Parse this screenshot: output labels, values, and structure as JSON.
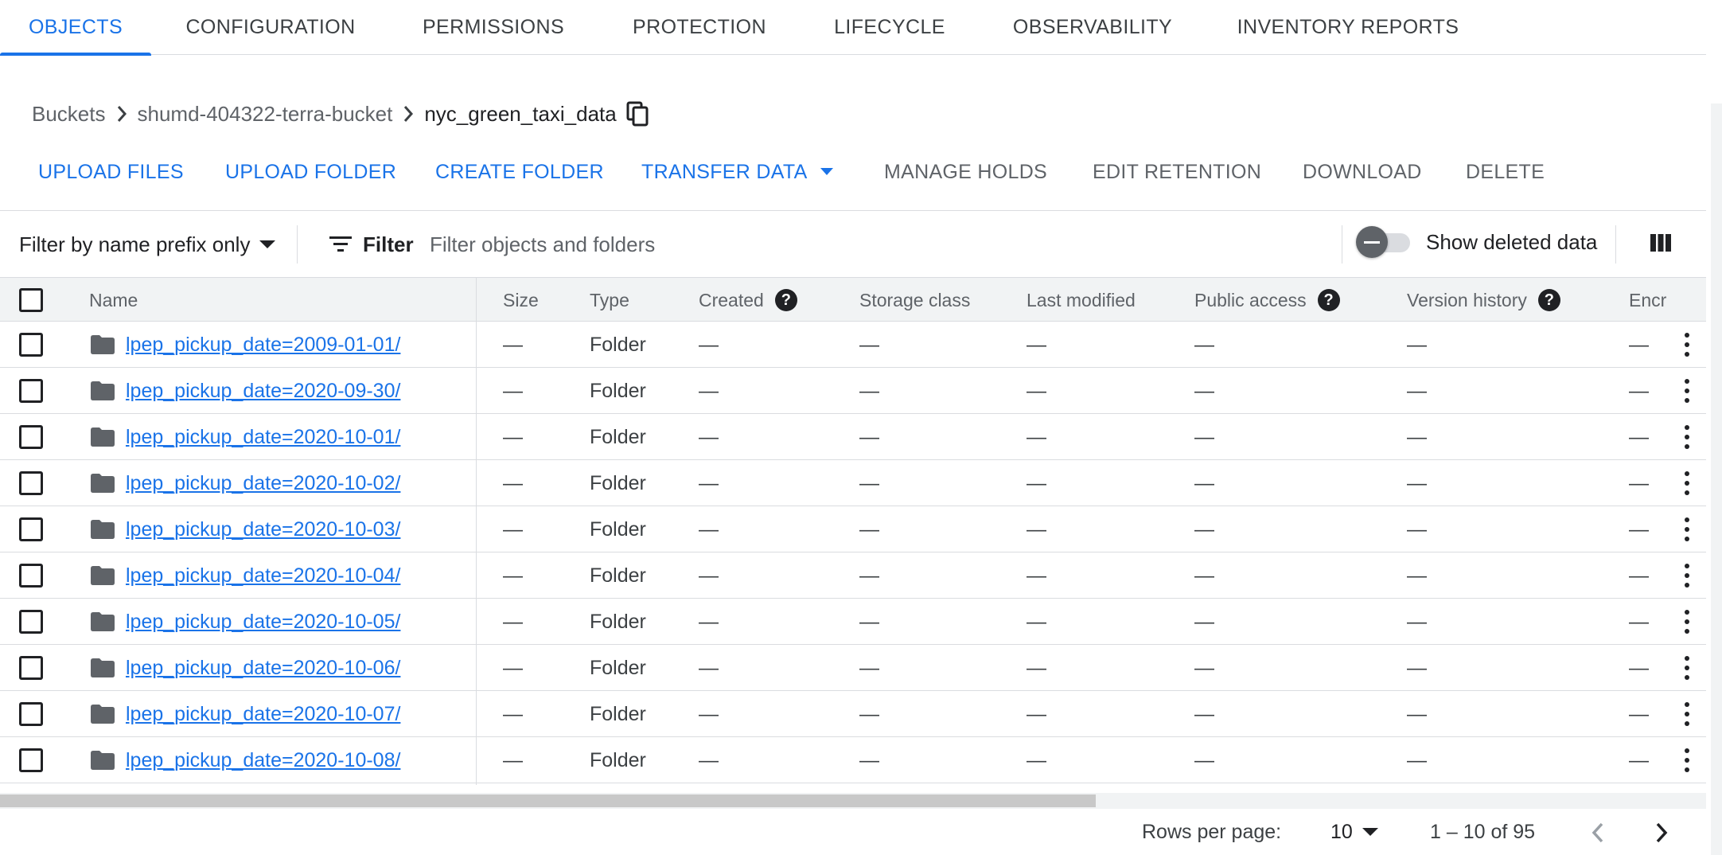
{
  "tabs": [
    {
      "label": "OBJECTS",
      "active": true
    },
    {
      "label": "CONFIGURATION",
      "active": false
    },
    {
      "label": "PERMISSIONS",
      "active": false
    },
    {
      "label": "PROTECTION",
      "active": false
    },
    {
      "label": "LIFECYCLE",
      "active": false
    },
    {
      "label": "OBSERVABILITY",
      "active": false
    },
    {
      "label": "INVENTORY REPORTS",
      "active": false
    }
  ],
  "breadcrumb": {
    "root": "Buckets",
    "bucket": "shumd-404322-terra-bucket",
    "current": "nyc_green_taxi_data"
  },
  "actions": {
    "upload_files": "UPLOAD FILES",
    "upload_folder": "UPLOAD FOLDER",
    "create_folder": "CREATE FOLDER",
    "transfer_data": "TRANSFER DATA",
    "manage_holds": "MANAGE HOLDS",
    "edit_retention": "EDIT RETENTION",
    "download": "DOWNLOAD",
    "delete": "DELETE"
  },
  "filter": {
    "mode": "Filter by name prefix only",
    "label": "Filter",
    "placeholder": "Filter objects and folders",
    "value": "",
    "show_deleted_label": "Show deleted data",
    "show_deleted": false
  },
  "table": {
    "headers": {
      "name": "Name",
      "size": "Size",
      "type": "Type",
      "created": "Created",
      "storage_class": "Storage class",
      "last_modified": "Last modified",
      "public_access": "Public access",
      "version_history": "Version history",
      "encryption": "Encr"
    },
    "help_glyph": "?",
    "rows": [
      {
        "name": "lpep_pickup_date=2009-01-01/",
        "size": "—",
        "type": "Folder",
        "created": "—",
        "storage_class": "—",
        "last_modified": "—",
        "public_access": "—",
        "version_history": "—",
        "encryption": "—"
      },
      {
        "name": "lpep_pickup_date=2020-09-30/",
        "size": "—",
        "type": "Folder",
        "created": "—",
        "storage_class": "—",
        "last_modified": "—",
        "public_access": "—",
        "version_history": "—",
        "encryption": "—"
      },
      {
        "name": "lpep_pickup_date=2020-10-01/",
        "size": "—",
        "type": "Folder",
        "created": "—",
        "storage_class": "—",
        "last_modified": "—",
        "public_access": "—",
        "version_history": "—",
        "encryption": "—"
      },
      {
        "name": "lpep_pickup_date=2020-10-02/",
        "size": "—",
        "type": "Folder",
        "created": "—",
        "storage_class": "—",
        "last_modified": "—",
        "public_access": "—",
        "version_history": "—",
        "encryption": "—"
      },
      {
        "name": "lpep_pickup_date=2020-10-03/",
        "size": "—",
        "type": "Folder",
        "created": "—",
        "storage_class": "—",
        "last_modified": "—",
        "public_access": "—",
        "version_history": "—",
        "encryption": "—"
      },
      {
        "name": "lpep_pickup_date=2020-10-04/",
        "size": "—",
        "type": "Folder",
        "created": "—",
        "storage_class": "—",
        "last_modified": "—",
        "public_access": "—",
        "version_history": "—",
        "encryption": "—"
      },
      {
        "name": "lpep_pickup_date=2020-10-05/",
        "size": "—",
        "type": "Folder",
        "created": "—",
        "storage_class": "—",
        "last_modified": "—",
        "public_access": "—",
        "version_history": "—",
        "encryption": "—"
      },
      {
        "name": "lpep_pickup_date=2020-10-06/",
        "size": "—",
        "type": "Folder",
        "created": "—",
        "storage_class": "—",
        "last_modified": "—",
        "public_access": "—",
        "version_history": "—",
        "encryption": "—"
      },
      {
        "name": "lpep_pickup_date=2020-10-07/",
        "size": "—",
        "type": "Folder",
        "created": "—",
        "storage_class": "—",
        "last_modified": "—",
        "public_access": "—",
        "version_history": "—",
        "encryption": "—"
      },
      {
        "name": "lpep_pickup_date=2020-10-08/",
        "size": "—",
        "type": "Folder",
        "created": "—",
        "storage_class": "—",
        "last_modified": "—",
        "public_access": "—",
        "version_history": "—",
        "encryption": "—"
      }
    ]
  },
  "pagination": {
    "rows_per_page_label": "Rows per page:",
    "rows_per_page": "10",
    "range": "1 – 10 of 95"
  },
  "colors": {
    "accent": "#1a73e8",
    "text": "#202124",
    "muted": "#5f6368",
    "border": "#dadce0",
    "header_bg": "#f1f3f4"
  },
  "icons": {
    "breadcrumb_separator": "chevron-right-icon",
    "copy": "copy-icon",
    "dropdown": "arrow-drop-down-icon",
    "filter": "filter-list-icon",
    "columns": "column-view-icon",
    "folder": "folder-icon",
    "row_menu": "more-vert-icon",
    "prev_page": "chevron-left-icon",
    "next_page": "chevron-right-icon"
  }
}
